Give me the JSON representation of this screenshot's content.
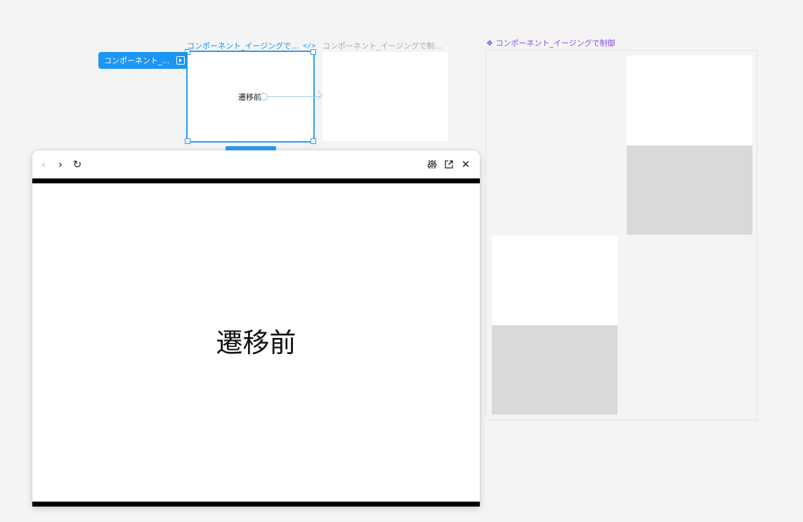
{
  "frames": {
    "frame1": {
      "label": "コンポーネント_イージングで…",
      "code_icon": "</>",
      "text": "遷移前"
    },
    "frame2": {
      "label": "コンポーネント_イージングで制…"
    }
  },
  "interaction_badge": {
    "label": "コンポーネント_…"
  },
  "component_set": {
    "label": "❖ コンポーネント_イージングで制御"
  },
  "preview": {
    "content_text": "遷移前",
    "toolbar": {
      "back_icon": "‹",
      "forward_icon": "›",
      "reload_icon": "↻",
      "settings_icon": "sliders-icon",
      "open_icon": "external-link-icon",
      "close_icon": "✕"
    }
  },
  "colors": {
    "selection": "#2f9bf0",
    "component": "#8a4fe0",
    "canvas": "#f4f4f4",
    "variant_fill": "#d9d9d9"
  }
}
